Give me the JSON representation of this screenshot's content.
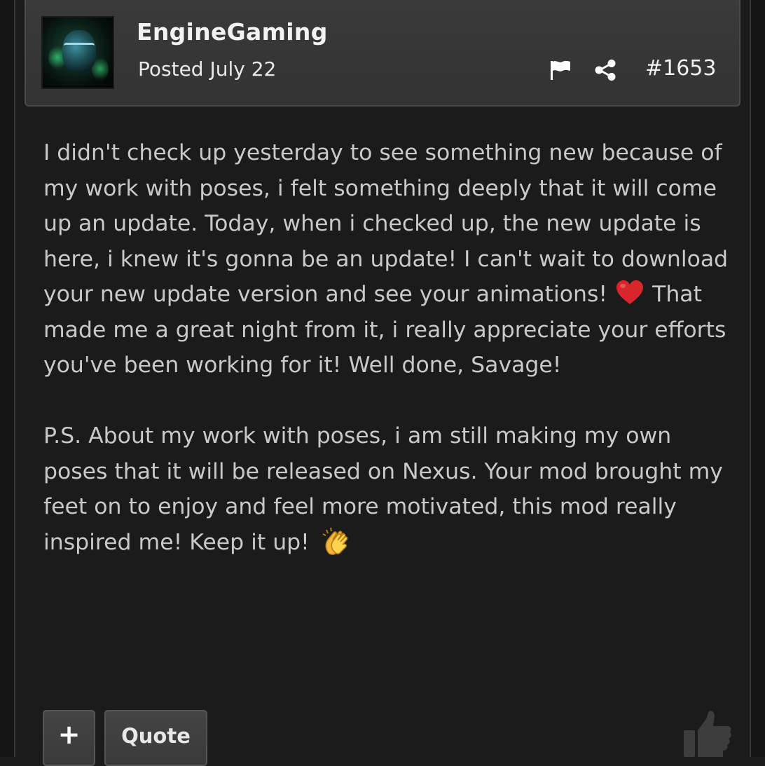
{
  "post": {
    "author": "EngineGaming",
    "posted": "Posted July 22",
    "number": "#1653",
    "paragraphs": [
      {
        "before_emoji": "I didn't check up yesterday to see something new because of my work with poses, i felt something deeply that it will come up an update. Today, when i checked up, the new update is here, i knew it's gonna be an update! I can't wait to download your new update version and see your animations! ",
        "emoji": "red-heart",
        "after_emoji": " That made me a great night from it, i really appreciate your efforts you've been working for it! Well done, Savage!"
      },
      {
        "before_emoji": "P.S. About my work with poses, i am still making my own poses that it will be released on Nexus. Your mod brought my feet on to enjoy and feel more motivated, this mod really inspired me! Keep it up! ",
        "emoji": "clapping-hands",
        "after_emoji": ""
      }
    ]
  },
  "actions": {
    "plus_label": "+",
    "quote_label": "Quote"
  },
  "icons": {
    "report": "flag-icon",
    "share": "share-icon",
    "reaction": "thumbs-up-icon"
  },
  "colors": {
    "background": "#1b1b1b",
    "header": "#373737",
    "text": "#c9c9c9",
    "heart": "#d8262c",
    "clap": "#f5c542"
  }
}
